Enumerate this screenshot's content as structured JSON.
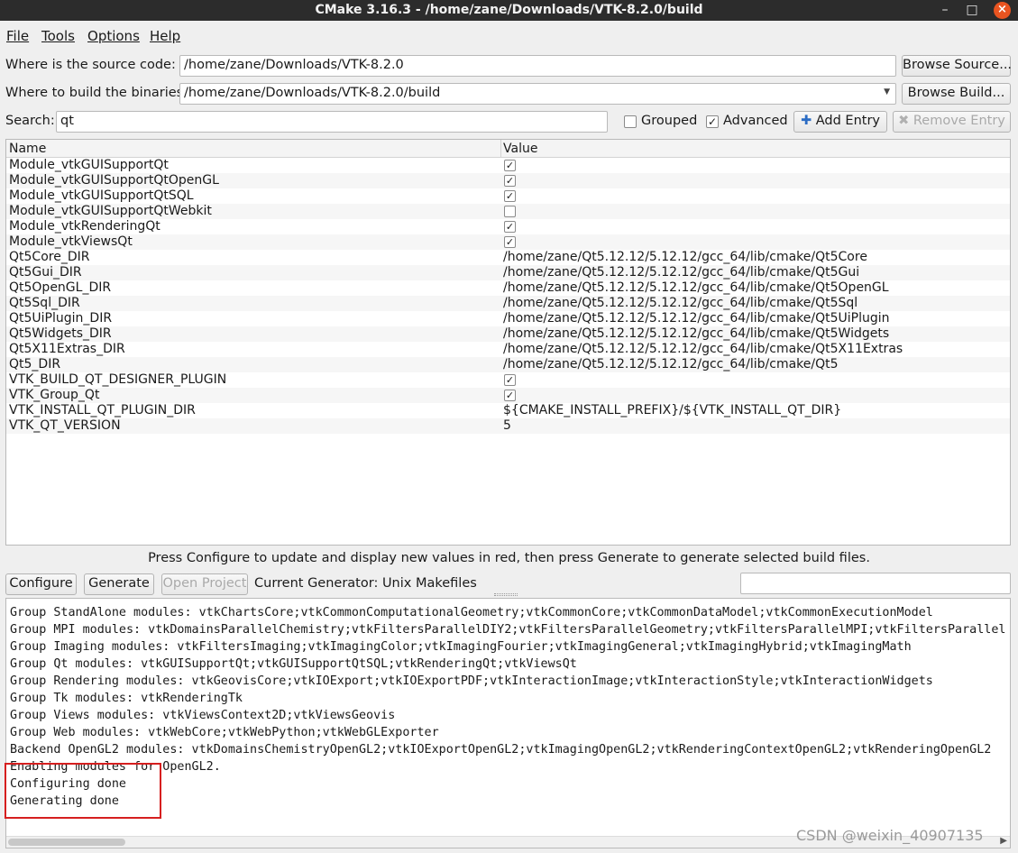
{
  "window": {
    "title": "CMake 3.16.3 - /home/zane/Downloads/VTK-8.2.0/build",
    "min_icon": "minimize-icon",
    "max_icon": "maximize-icon",
    "close_icon": "close-icon"
  },
  "menu": [
    "File",
    "Tools",
    "Options",
    "Help"
  ],
  "source": {
    "label": "Where is the source code:",
    "value": "/home/zane/Downloads/VTK-8.2.0",
    "button": "Browse Source..."
  },
  "binaries": {
    "label": "Where to build the binaries:",
    "value": "/home/zane/Downloads/VTK-8.2.0/build",
    "button": "Browse Build..."
  },
  "search": {
    "label": "Search:",
    "value": "qt",
    "grouped_label": "Grouped",
    "grouped_checked": false,
    "advanced_label": "Advanced",
    "advanced_checked": true,
    "add_entry": "Add Entry",
    "remove_entry": "Remove Entry"
  },
  "table": {
    "headers": [
      "Name",
      "Value"
    ],
    "rows": [
      {
        "name": "Module_vtkGUISupportQt",
        "type": "bool",
        "checked": true
      },
      {
        "name": "Module_vtkGUISupportQtOpenGL",
        "type": "bool",
        "checked": true
      },
      {
        "name": "Module_vtkGUISupportQtSQL",
        "type": "bool",
        "checked": true
      },
      {
        "name": "Module_vtkGUISupportQtWebkit",
        "type": "bool",
        "checked": false
      },
      {
        "name": "Module_vtkRenderingQt",
        "type": "bool",
        "checked": true
      },
      {
        "name": "Module_vtkViewsQt",
        "type": "bool",
        "checked": true
      },
      {
        "name": "Qt5Core_DIR",
        "type": "text",
        "value": "/home/zane/Qt5.12.12/5.12.12/gcc_64/lib/cmake/Qt5Core"
      },
      {
        "name": "Qt5Gui_DIR",
        "type": "text",
        "value": "/home/zane/Qt5.12.12/5.12.12/gcc_64/lib/cmake/Qt5Gui"
      },
      {
        "name": "Qt5OpenGL_DIR",
        "type": "text",
        "value": "/home/zane/Qt5.12.12/5.12.12/gcc_64/lib/cmake/Qt5OpenGL"
      },
      {
        "name": "Qt5Sql_DIR",
        "type": "text",
        "value": "/home/zane/Qt5.12.12/5.12.12/gcc_64/lib/cmake/Qt5Sql"
      },
      {
        "name": "Qt5UiPlugin_DIR",
        "type": "text",
        "value": "/home/zane/Qt5.12.12/5.12.12/gcc_64/lib/cmake/Qt5UiPlugin"
      },
      {
        "name": "Qt5Widgets_DIR",
        "type": "text",
        "value": "/home/zane/Qt5.12.12/5.12.12/gcc_64/lib/cmake/Qt5Widgets"
      },
      {
        "name": "Qt5X11Extras_DIR",
        "type": "text",
        "value": "/home/zane/Qt5.12.12/5.12.12/gcc_64/lib/cmake/Qt5X11Extras"
      },
      {
        "name": "Qt5_DIR",
        "type": "text",
        "value": "/home/zane/Qt5.12.12/5.12.12/gcc_64/lib/cmake/Qt5"
      },
      {
        "name": "VTK_BUILD_QT_DESIGNER_PLUGIN",
        "type": "bool",
        "checked": true
      },
      {
        "name": "VTK_Group_Qt",
        "type": "bool",
        "checked": true
      },
      {
        "name": "VTK_INSTALL_QT_PLUGIN_DIR",
        "type": "text",
        "value": "${CMAKE_INSTALL_PREFIX}/${VTK_INSTALL_QT_DIR}"
      },
      {
        "name": "VTK_QT_VERSION",
        "type": "text",
        "value": "5"
      }
    ]
  },
  "hint": "Press Configure to update and display new values in red, then press Generate to generate selected build files.",
  "actions": {
    "configure": "Configure",
    "generate": "Generate",
    "open_project": "Open Project",
    "generator": "Current Generator: Unix Makefiles"
  },
  "log": [
    "Group StandAlone modules: vtkChartsCore;vtkCommonComputationalGeometry;vtkCommonCore;vtkCommonDataModel;vtkCommonExecutionModel",
    "Group MPI modules: vtkDomainsParallelChemistry;vtkFiltersParallelDIY2;vtkFiltersParallelGeometry;vtkFiltersParallelMPI;vtkFiltersParallel",
    "Group Imaging modules: vtkFiltersImaging;vtkImagingColor;vtkImagingFourier;vtkImagingGeneral;vtkImagingHybrid;vtkImagingMath",
    "Group Qt modules: vtkGUISupportQt;vtkGUISupportQtSQL;vtkRenderingQt;vtkViewsQt",
    "Group Rendering modules: vtkGeovisCore;vtkIOExport;vtkIOExportPDF;vtkInteractionImage;vtkInteractionStyle;vtkInteractionWidgets",
    "Group Tk modules: vtkRenderingTk",
    "Group Views modules: vtkViewsContext2D;vtkViewsGeovis",
    "Group Web modules: vtkWebCore;vtkWebPython;vtkWebGLExporter",
    "Backend OpenGL2 modules: vtkDomainsChemistryOpenGL2;vtkIOExportOpenGL2;vtkImagingOpenGL2;vtkRenderingContextOpenGL2;vtkRenderingOpenGL2",
    "Enabling modules for OpenGL2.",
    "Configuring done",
    "Generating done"
  ],
  "watermark": "CSDN @weixin_40907135",
  "colors": {
    "titlebar": "#2c2c2c",
    "close_button": "#e95420",
    "highlight_box": "#d61f1f"
  }
}
